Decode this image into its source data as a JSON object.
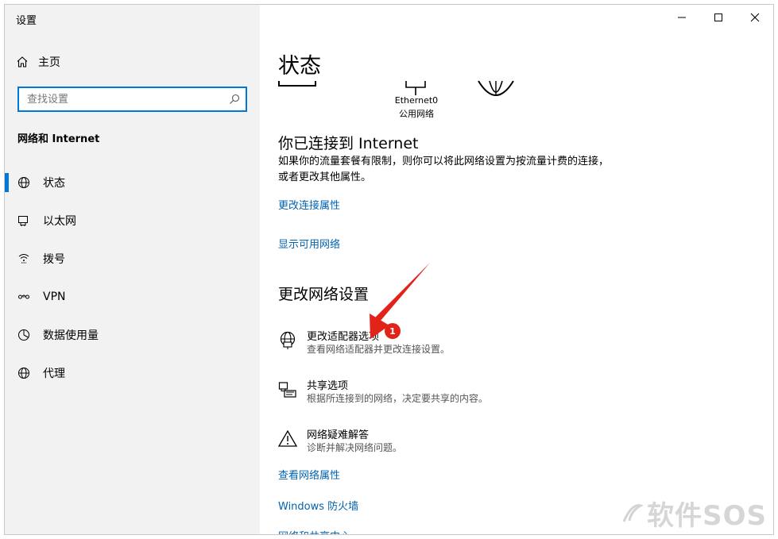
{
  "window": {
    "title": "设置"
  },
  "sidebar": {
    "home_label": "主页",
    "search_placeholder": "查找设置",
    "section_title": "网络和 Internet",
    "items": [
      {
        "label": "状态",
        "icon": "globe-icon",
        "active": true
      },
      {
        "label": "以太网",
        "icon": "ethernet-icon",
        "active": false
      },
      {
        "label": "拨号",
        "icon": "dialup-icon",
        "active": false
      },
      {
        "label": "VPN",
        "icon": "vpn-icon",
        "active": false
      },
      {
        "label": "数据使用量",
        "icon": "data-usage-icon",
        "active": false
      },
      {
        "label": "代理",
        "icon": "globe-icon",
        "active": false
      }
    ]
  },
  "main": {
    "title": "状态",
    "network": {
      "name": "Ethernet0",
      "type": "公用网络"
    },
    "status_heading": "你已连接到 Internet",
    "status_desc": "如果你的流量套餐有限制，则你可以将此网络设置为按流量计费的连接，或者更改其他属性。",
    "links_top": [
      "更改连接属性",
      "显示可用网络"
    ],
    "change_heading": "更改网络设置",
    "options": [
      {
        "title": "更改适配器选项",
        "desc": "查看网络适配器并更改连接设置。",
        "icon": "adapter-globe-icon"
      },
      {
        "title": "共享选项",
        "desc": "根据所连接到的网络，决定要共享的内容。",
        "icon": "sharing-icon"
      },
      {
        "title": "网络疑难解答",
        "desc": "诊断并解决网络问题。",
        "icon": "warning-icon"
      }
    ],
    "links_bottom": [
      "查看网络属性",
      "Windows 防火墙",
      "网络和共享中心"
    ]
  },
  "annotation": {
    "badge": "1",
    "color": "#e2231a"
  },
  "watermark": "软件SOS"
}
